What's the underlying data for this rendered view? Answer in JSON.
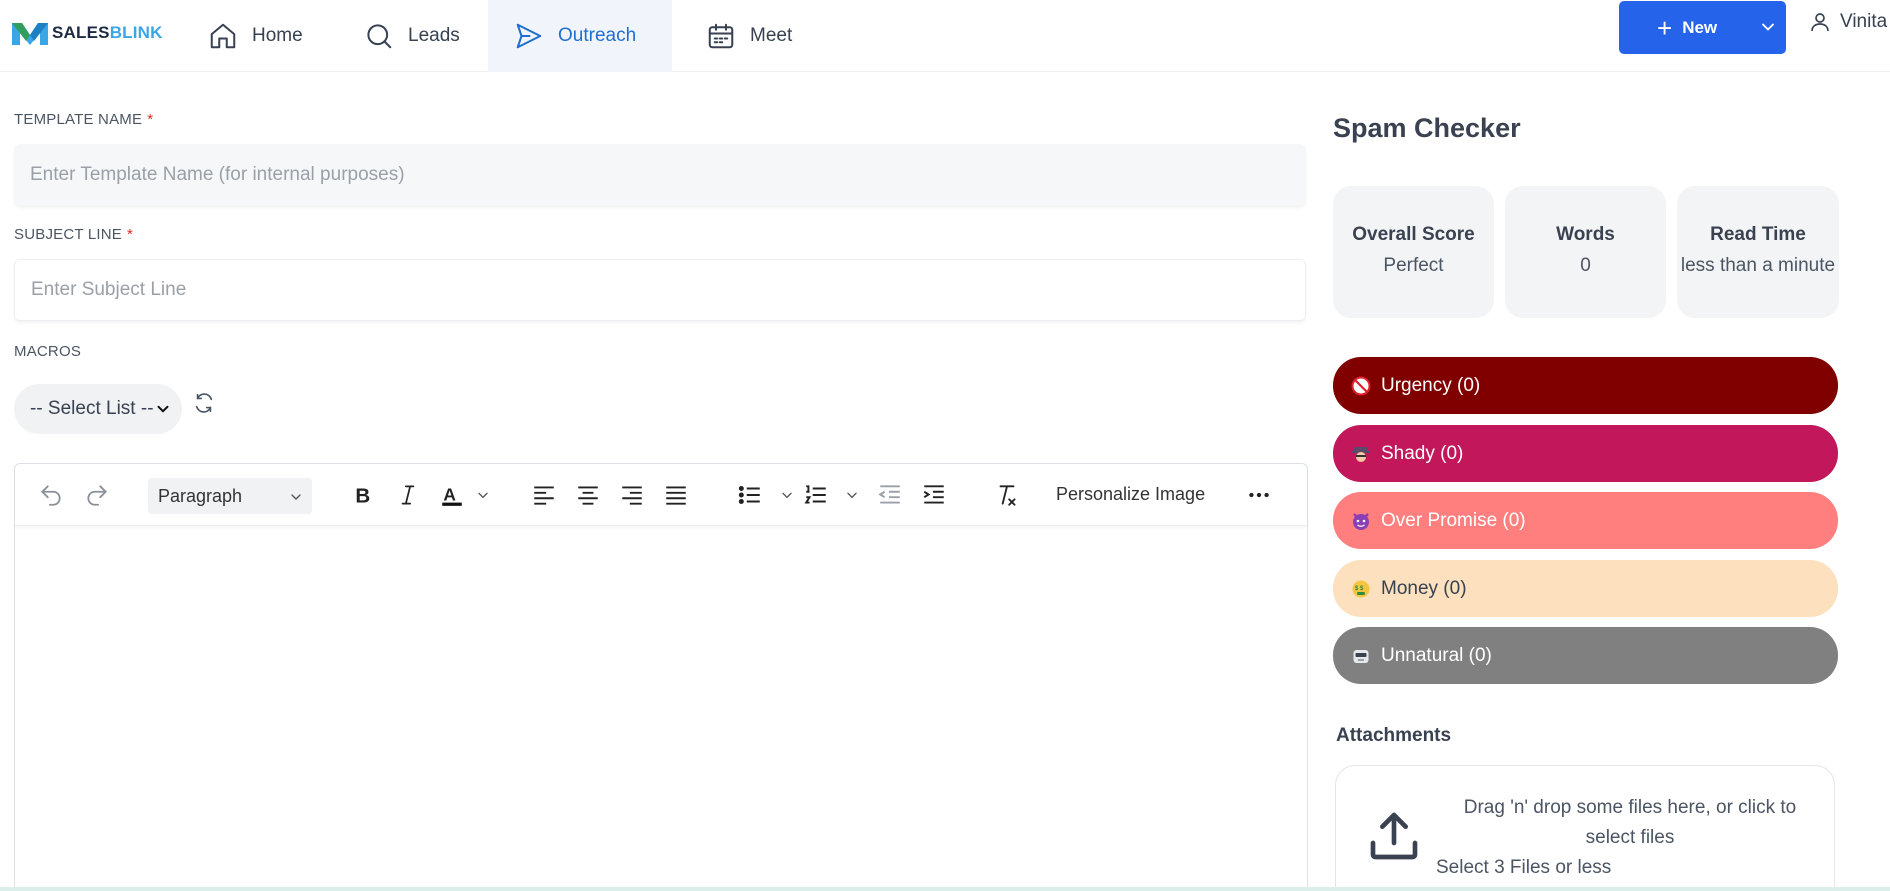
{
  "brand": {
    "part1": "SALES",
    "part2": "BLINK"
  },
  "nav": {
    "home": "Home",
    "leads": "Leads",
    "outreach": "Outreach",
    "meet": "Meet"
  },
  "header": {
    "new_label": "New",
    "user_name": "Vinita"
  },
  "form": {
    "template_label": "TEMPLATE NAME",
    "template_placeholder": "Enter Template Name (for internal purposes)",
    "template_value": "",
    "subject_label": "SUBJECT LINE",
    "subject_placeholder": "Enter Subject Line",
    "subject_value": "",
    "required_mark": "*",
    "macros_label": "MACROS",
    "macros_select": "-- Select List --"
  },
  "editor": {
    "block_format": "Paragraph",
    "personalize_image": "Personalize Image",
    "text_color": "#111111",
    "body": ""
  },
  "spam_checker": {
    "title": "Spam Checker",
    "cards": {
      "score_title": "Overall Score",
      "score_value": "Perfect",
      "words_title": "Words",
      "words_value": "0",
      "read_title": "Read Time",
      "read_value": "less than a minute"
    },
    "categories": {
      "urgency": "Urgency (0)",
      "shady": "Shady (0)",
      "over_promise": "Over Promise (0)",
      "money": "Money (0)",
      "unnatural": "Unnatural (0)"
    },
    "colors": {
      "urgency": "#800000",
      "shady": "#c2185b",
      "over_promise": "#ff7f7f",
      "money": "#fde0bd",
      "unnatural": "#808080"
    }
  },
  "attachments": {
    "title": "Attachments",
    "dropzone_text": "Drag 'n' drop some files here, or click to select files",
    "limit_text": "Select 3 Files or less"
  },
  "accent_color": "#2563eb"
}
